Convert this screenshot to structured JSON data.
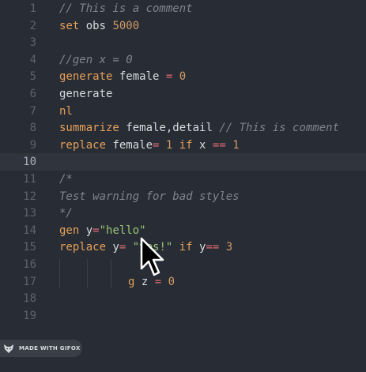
{
  "editor": {
    "lines": [
      {
        "num": "1",
        "tokens": [
          {
            "t": "// This is a comment",
            "c": "cmt"
          }
        ]
      },
      {
        "num": "2",
        "tokens": [
          {
            "t": "set ",
            "c": "kw"
          },
          {
            "t": "obs ",
            "c": ""
          },
          {
            "t": "5000",
            "c": "num"
          }
        ]
      },
      {
        "num": "3",
        "tokens": []
      },
      {
        "num": "4",
        "tokens": [
          {
            "t": "//gen x = 0",
            "c": "cmt"
          }
        ]
      },
      {
        "num": "5",
        "tokens": [
          {
            "t": "generate ",
            "c": "kw"
          },
          {
            "t": "female ",
            "c": ""
          },
          {
            "t": "= ",
            "c": "op"
          },
          {
            "t": "0",
            "c": "num"
          }
        ]
      },
      {
        "num": "6",
        "tokens": [
          {
            "t": "generate",
            "c": ""
          }
        ]
      },
      {
        "num": "7",
        "tokens": [
          {
            "t": "nl",
            "c": "kw"
          }
        ]
      },
      {
        "num": "8",
        "tokens": [
          {
            "t": "summarize ",
            "c": "kw"
          },
          {
            "t": "female,detail ",
            "c": ""
          },
          {
            "t": "// This is comment",
            "c": "cmt"
          }
        ]
      },
      {
        "num": "9",
        "tokens": [
          {
            "t": "replace ",
            "c": "kw"
          },
          {
            "t": "female",
            "c": ""
          },
          {
            "t": "= ",
            "c": "op"
          },
          {
            "t": "1 ",
            "c": "num"
          },
          {
            "t": "if ",
            "c": "kw"
          },
          {
            "t": "x ",
            "c": ""
          },
          {
            "t": "== ",
            "c": "op"
          },
          {
            "t": "1",
            "c": "num"
          }
        ]
      },
      {
        "num": "10",
        "tokens": []
      },
      {
        "num": "11",
        "tokens": [
          {
            "t": "/*",
            "c": "cmt"
          }
        ]
      },
      {
        "num": "12",
        "tokens": [
          {
            "t": "Test warning for bad styles",
            "c": "cmt"
          }
        ]
      },
      {
        "num": "13",
        "tokens": [
          {
            "t": "*/",
            "c": "cmt"
          }
        ]
      },
      {
        "num": "14",
        "tokens": [
          {
            "t": "gen ",
            "c": "kw"
          },
          {
            "t": "y",
            "c": ""
          },
          {
            "t": "=",
            "c": "op"
          },
          {
            "t": "\"hello\"",
            "c": "str"
          }
        ]
      },
      {
        "num": "15",
        "tokens": [
          {
            "t": "replace ",
            "c": "kw"
          },
          {
            "t": "y",
            "c": ""
          },
          {
            "t": "= ",
            "c": "op"
          },
          {
            "t": "\"yes!\" ",
            "c": "str"
          },
          {
            "t": "if ",
            "c": "kw"
          },
          {
            "t": "y",
            "c": ""
          },
          {
            "t": "== ",
            "c": "op"
          },
          {
            "t": "3",
            "c": "num"
          }
        ]
      },
      {
        "num": "16",
        "tokens": []
      },
      {
        "num": "17",
        "indent": true,
        "tokens": [
          {
            "t": "g ",
            "c": "kw"
          },
          {
            "t": "z ",
            "c": ""
          },
          {
            "t": "= ",
            "c": "op"
          },
          {
            "t": "0",
            "c": "num"
          }
        ]
      },
      {
        "num": "18",
        "tokens": []
      },
      {
        "num": "19",
        "tokens": []
      }
    ],
    "active_line": "10"
  },
  "badge": {
    "label": "MADE WITH GIFOX"
  },
  "icons": {
    "badge_logo": "fox-icon",
    "pointer": "mouse-pointer-icon"
  },
  "colors": {
    "background": "#282c34",
    "keyword": "#e5a05a",
    "number": "#d19a66",
    "string": "#98c379",
    "comment": "#7f848e"
  }
}
